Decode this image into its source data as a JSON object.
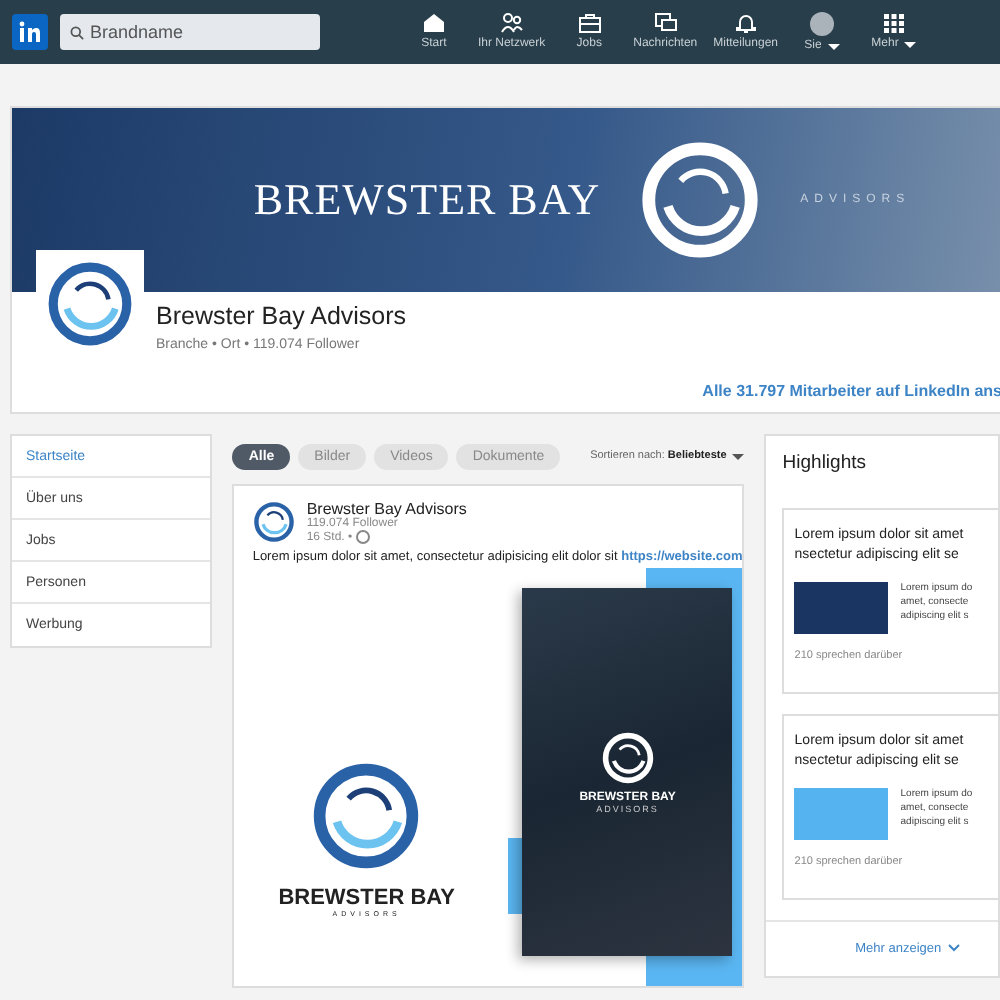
{
  "topbar": {
    "search": {
      "placeholder": "Brandname"
    },
    "nav": [
      {
        "kind": "home",
        "label": "Start",
        "caret": false
      },
      {
        "kind": "network",
        "label": "Ihr Netzwerk",
        "caret": false
      },
      {
        "kind": "jobs",
        "label": "Jobs",
        "caret": false
      },
      {
        "kind": "messages",
        "label": "Nachrichten",
        "caret": false
      },
      {
        "kind": "bell",
        "label": "Mitteilungen",
        "caret": false
      },
      {
        "kind": "avatar",
        "label": "Sie",
        "caret": true
      },
      {
        "kind": "grid",
        "label": "Mehr",
        "caret": true
      }
    ]
  },
  "cover": {
    "brand": "BREWSTER BAY",
    "tagline": "ADVISORS"
  },
  "company": {
    "name": "Brewster Bay Advisors",
    "meta": "Branche • Ort • 119.074 Follower",
    "employees_link": "Alle 31.797 Mitarbeiter auf LinkedIn ans"
  },
  "sidebar": {
    "items": [
      {
        "label": "Startseite",
        "selected": true
      },
      {
        "label": "Über uns",
        "selected": false
      },
      {
        "label": "Jobs",
        "selected": false
      },
      {
        "label": "Personen",
        "selected": false
      },
      {
        "label": "Werbung",
        "selected": false
      }
    ]
  },
  "filters": [
    {
      "label": "Alle",
      "selected": true
    },
    {
      "label": "Bilder",
      "selected": false
    },
    {
      "label": "Videos",
      "selected": false
    },
    {
      "label": "Dokumente",
      "selected": false
    }
  ],
  "sort": {
    "label": "Sortieren nach:",
    "value": "Beliebteste"
  },
  "post": {
    "author": "Brewster Bay Advisors",
    "followers": "119.074 Follower",
    "time": "16 Std. •",
    "text": "Lorem ipsum dolor sit amet, consectetur adipisicing elit dolor sit",
    "link": "https://website.com",
    "image": {
      "brand": "BREWSTER BAY",
      "tagline": "ADVISORS",
      "card_brand": "BREWSTER BAY",
      "card_tagline": "ADVISORS"
    }
  },
  "highlights": {
    "title": "Highlights",
    "items": [
      {
        "title_lines": [
          "Lorem ipsum dolor sit amet",
          "nsectetur adipiscing elit se"
        ],
        "color": "#1b3563",
        "body_lines": [
          "Lorem ipsum do",
          "amet, consecte",
          "adipiscing elit s"
        ],
        "count": "210 sprechen darüber"
      },
      {
        "title_lines": [
          "Lorem ipsum dolor sit amet",
          "nsectetur adipiscing elit se"
        ],
        "color": "#55b3f0",
        "body_lines": [
          "Lorem ipsum do",
          "amet, consecte",
          "adipiscing elit s"
        ],
        "count": "210 sprechen darüber"
      }
    ],
    "more": "Mehr anzeigen"
  }
}
